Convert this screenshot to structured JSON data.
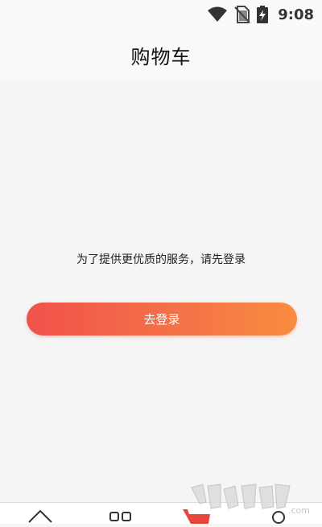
{
  "status_bar": {
    "time": "9:08",
    "icons": [
      "wifi-icon",
      "no-sim-icon",
      "battery-charging-icon"
    ]
  },
  "header": {
    "title": "购物车"
  },
  "main": {
    "prompt": "为了提供更优质的服务，请先登录",
    "login_button_label": "去登录"
  },
  "tab_bar": {
    "tabs": [
      {
        "icon": "home-icon",
        "active": false
      },
      {
        "icon": "category-icon",
        "active": false
      },
      {
        "icon": "cart-icon",
        "active": true
      },
      {
        "icon": "profile-icon",
        "active": false
      }
    ]
  },
  "watermark": {
    "text": "9k9k.com"
  },
  "colors": {
    "button_gradient_start": "#f0524a",
    "button_gradient_end": "#f98c3e",
    "active_tab": "#e8463c",
    "background": "#f5f5f5"
  }
}
